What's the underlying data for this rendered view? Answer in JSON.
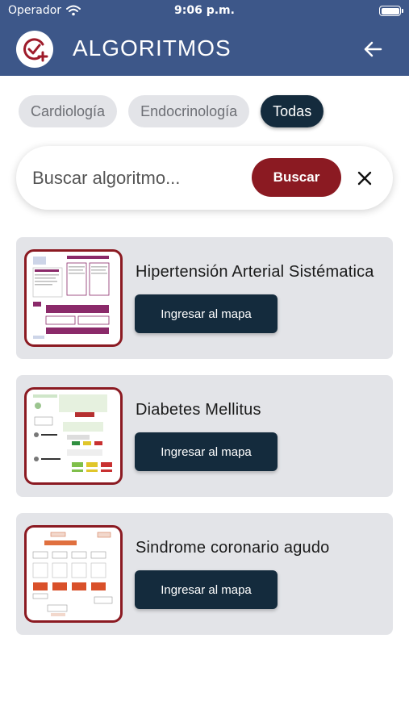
{
  "status": {
    "carrier": "Operador",
    "time": "9:06 p.m."
  },
  "header": {
    "title": "ALGORITMOS"
  },
  "filters": [
    "Cardiología",
    "Endocrinología",
    "Todas"
  ],
  "search": {
    "placeholder": "Buscar algoritmo...",
    "button": "Buscar"
  },
  "cards": [
    {
      "title": "Hipertensión Arterial Sistématica",
      "button": "Ingresar al mapa"
    },
    {
      "title": "Diabetes Mellitus",
      "button": "Ingresar al mapa"
    },
    {
      "title": "Sindrome coronario agudo",
      "button": "Ingresar al mapa"
    }
  ],
  "colors": {
    "header": "#3d5789",
    "primary_dark": "#142b3d",
    "accent_red": "#8b1a22",
    "card_bg": "#e3e4e8"
  }
}
